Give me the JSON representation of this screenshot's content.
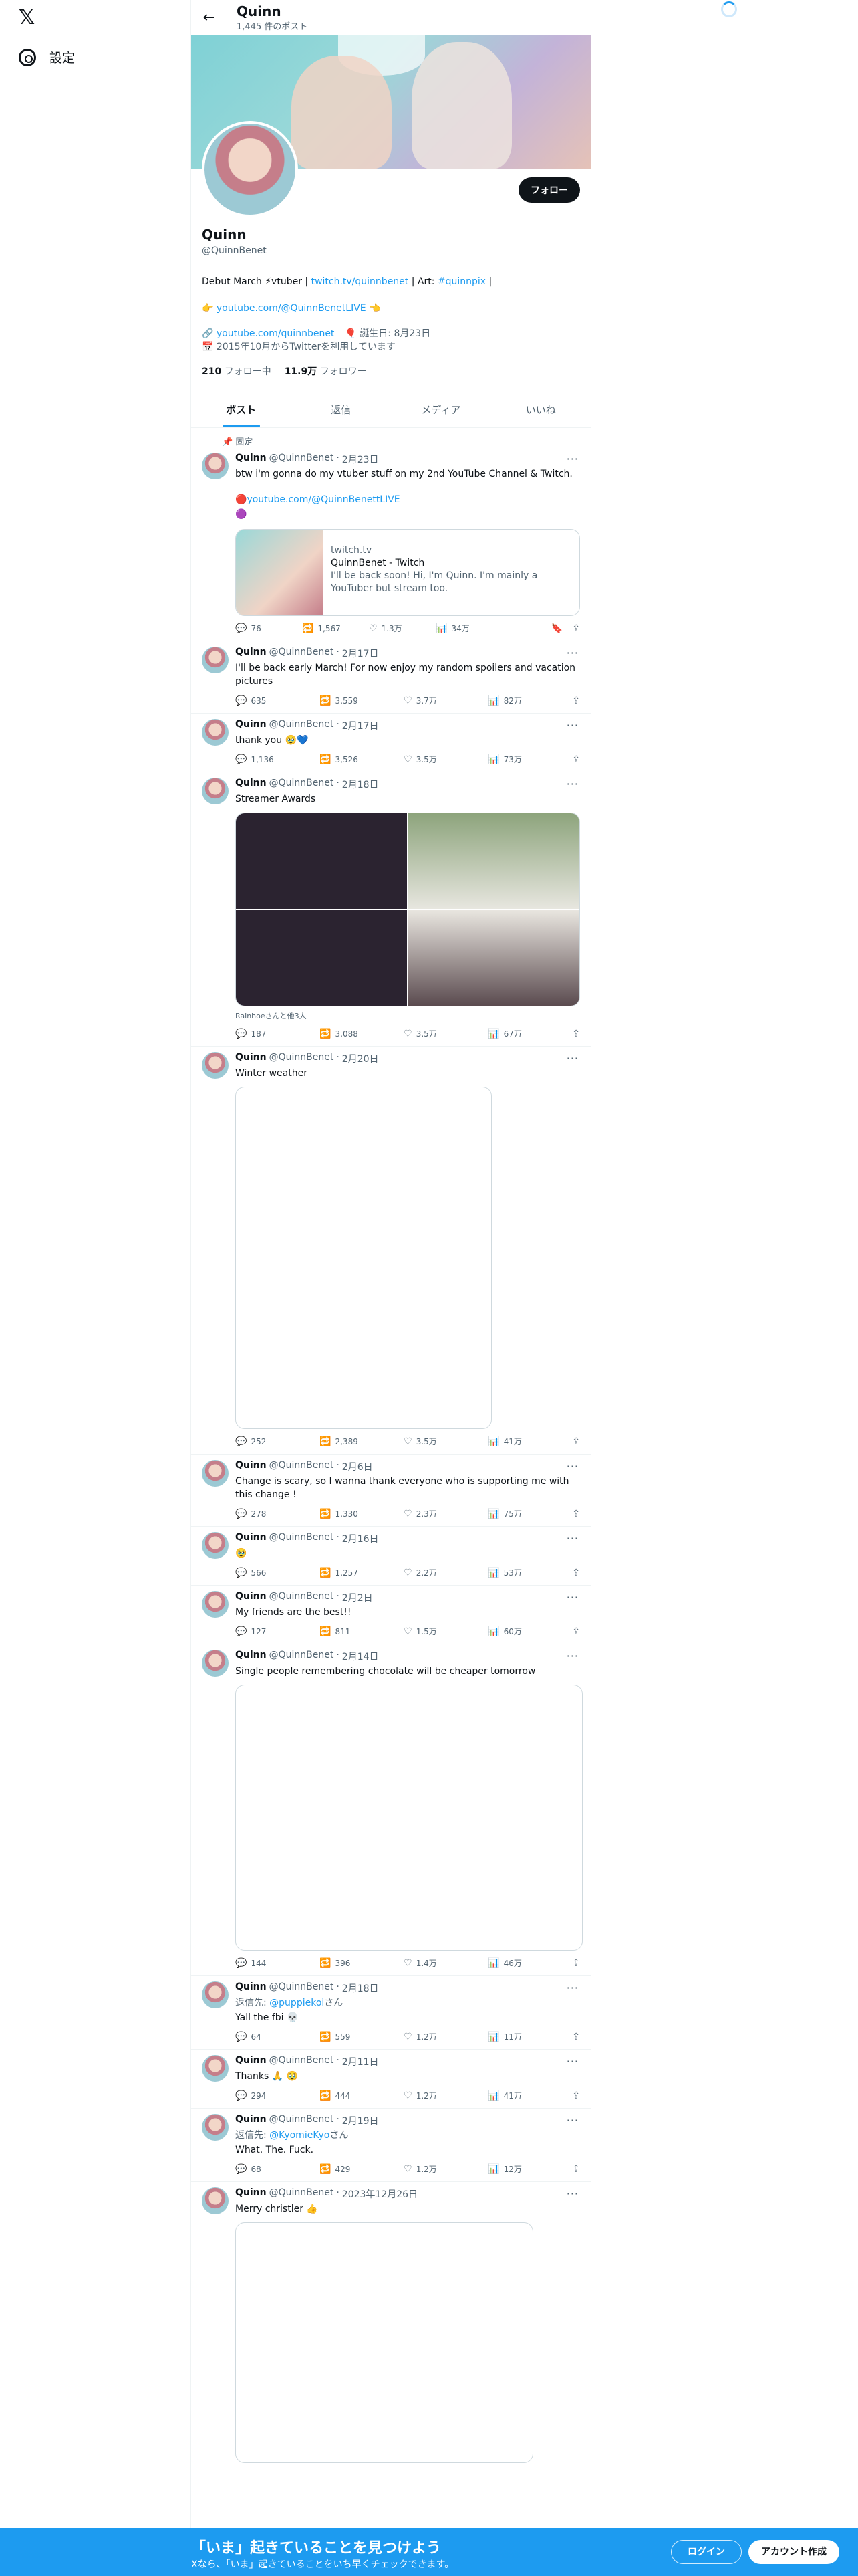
{
  "sidebar": {
    "logo": "𝕏",
    "settings_label": "設定"
  },
  "header": {
    "name": "Quinn",
    "post_count": "1,445 件のポスト"
  },
  "profile": {
    "follow_label": "フォロー",
    "name": "Quinn",
    "handle": "@QuinnBenet",
    "bio_prefix": "Debut March ⚡vtuber | ",
    "bio_link1": "twitch.tv/quinnbenet",
    "bio_mid": " | Art: ",
    "bio_link2": "#quinnpix",
    "bio_suffix": " |",
    "bio2_prefix": "👉 ",
    "bio2_link": "youtube.com/@QuinnBenetLIVE",
    "bio2_suffix": " 👈",
    "website": "youtube.com/quinnbenet",
    "birthday": "誕生日: 8月23日",
    "joined": "2015年10月からTwitterを利用しています",
    "following_count": "210",
    "following_label": "フォロー中",
    "followers_count": "11.9万",
    "followers_label": "フォロワー"
  },
  "tabs": [
    "ポスト",
    "返信",
    "メディア",
    "いいね"
  ],
  "pinned_label": "固定",
  "tweets": [
    {
      "name": "Quinn",
      "handle": "@QuinnBenet",
      "date": "2月23日",
      "text": "btw i'm gonna do my vtuber stuff on my 2nd YouTube Channel & Twitch.",
      "link": "youtube.com/@QuinnBenettLIVE",
      "card_domain": "twitch.tv",
      "card_title": "QuinnBenet - Twitch",
      "card_desc": "I'll be back soon! Hi, I'm Quinn. I'm mainly a YouTuber but stream too.",
      "replies": "76",
      "retweets": "1,567",
      "likes": "1.3万",
      "views": "34万"
    },
    {
      "name": "Quinn",
      "handle": "@QuinnBenet",
      "date": "2月17日",
      "text": "I'll be back early March! For now enjoy my random spoilers and vacation pictures",
      "replies": "635",
      "retweets": "3,559",
      "likes": "3.7万",
      "views": "82万"
    },
    {
      "name": "Quinn",
      "handle": "@QuinnBenet",
      "date": "2月17日",
      "text": "thank you 🥹💙",
      "replies": "1,136",
      "retweets": "3,526",
      "likes": "3.5万",
      "views": "73万"
    },
    {
      "name": "Quinn",
      "handle": "@QuinnBenet",
      "date": "2月18日",
      "text": "Streamer Awards",
      "tagline": "Rainhoeさんと他3人",
      "replies": "187",
      "retweets": "3,088",
      "likes": "3.5万",
      "views": "67万"
    },
    {
      "name": "Quinn",
      "handle": "@QuinnBenet",
      "date": "2月20日",
      "text": "Winter weather",
      "replies": "252",
      "retweets": "2,389",
      "likes": "3.5万",
      "views": "41万"
    },
    {
      "name": "Quinn",
      "handle": "@QuinnBenet",
      "date": "2月6日",
      "text": "Change is scary, so I wanna thank everyone who is supporting me with this change !",
      "replies": "278",
      "retweets": "1,330",
      "likes": "2.3万",
      "views": "75万"
    },
    {
      "name": "Quinn",
      "handle": "@QuinnBenet",
      "date": "2月16日",
      "text": "🥹",
      "replies": "566",
      "retweets": "1,257",
      "likes": "2.2万",
      "views": "53万"
    },
    {
      "name": "Quinn",
      "handle": "@QuinnBenet",
      "date": "2月2日",
      "text": "My friends are the best!!",
      "replies": "127",
      "retweets": "811",
      "likes": "1.5万",
      "views": "60万"
    },
    {
      "name": "Quinn",
      "handle": "@QuinnBenet",
      "date": "2月14日",
      "text": "Single people remembering chocolate will be cheaper tomorrow",
      "replies": "144",
      "retweets": "396",
      "likes": "1.4万",
      "views": "46万"
    },
    {
      "name": "Quinn",
      "handle": "@QuinnBenet",
      "date": "2月18日",
      "reply_prefix": "返信先: ",
      "reply_to": "@puppiekoi",
      "reply_suffix": "さん",
      "text": "Yall the fbi 💀",
      "replies": "64",
      "retweets": "559",
      "likes": "1.2万",
      "views": "11万"
    },
    {
      "name": "Quinn",
      "handle": "@QuinnBenet",
      "date": "2月11日",
      "text": "Thanks 🙏 🥹",
      "replies": "294",
      "retweets": "444",
      "likes": "1.2万",
      "views": "41万"
    },
    {
      "name": "Quinn",
      "handle": "@QuinnBenet",
      "date": "2月19日",
      "reply_prefix": "返信先: ",
      "reply_to": "@KyomieKyo",
      "reply_suffix": "さん",
      "text": "What. The. Fuck.",
      "replies": "68",
      "retweets": "429",
      "likes": "1.2万",
      "views": "12万"
    },
    {
      "name": "Quinn",
      "handle": "@QuinnBenet",
      "date": "2023年12月26日",
      "text": "Merry christler 👍"
    }
  ],
  "bottom_bar": {
    "title": "「いま」起きていることを見つけよう",
    "subtitle": "Xなら、「いま」起きていることをいち早くチェックできます。",
    "login_label": "ログイン",
    "signup_label": "アカウント作成"
  },
  "icons": {
    "reply": "reply-icon",
    "retweet": "retweet-icon",
    "like": "heart-icon",
    "views": "views-icon",
    "share": "share-icon",
    "bookmark": "bookmark-icon"
  },
  "colors": {
    "accent": "#1d9bf0",
    "text": "#0f1419",
    "muted": "#536471"
  }
}
